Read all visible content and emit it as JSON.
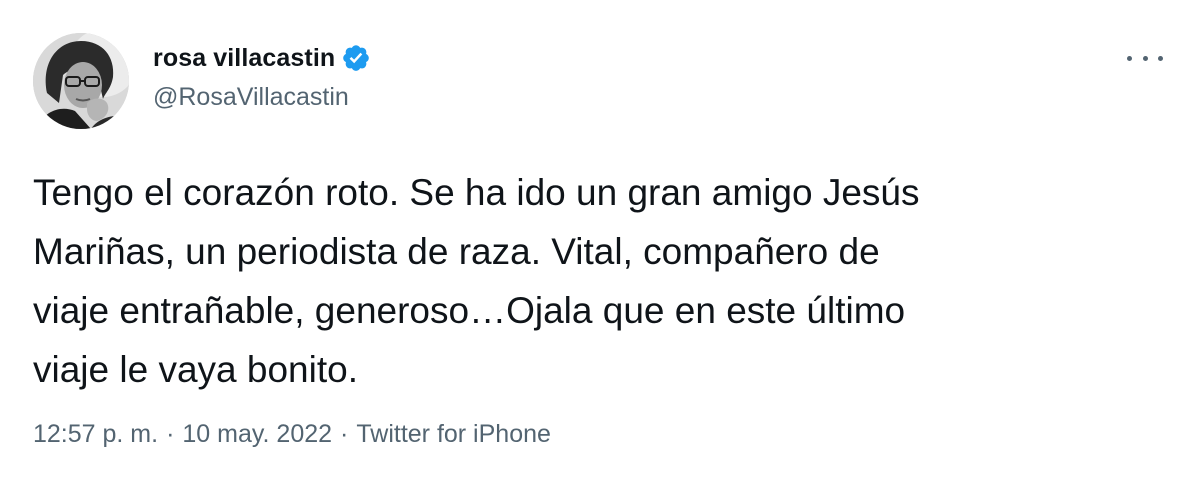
{
  "author": {
    "display_name": "rosa villacastin",
    "handle": "@RosaVillacastin",
    "verified": true
  },
  "icons": {
    "verified": "verified-badge-icon",
    "more": "more-options-icon"
  },
  "colors": {
    "verified_badge": "#1d9bf0",
    "secondary_text": "#536471",
    "primary_text": "#0f1419"
  },
  "tweet": {
    "text": "Tengo el corazón roto. Se ha ido un gran amigo Jesús\nMariñas, un periodista de raza. Vital, compañero de\nviaje entrañable, generoso…Ojala que en este último\nviaje le vaya bonito.",
    "time": "12:57 p. m.",
    "date": "10 may. 2022",
    "source": "Twitter for iPhone",
    "separator": "·"
  }
}
